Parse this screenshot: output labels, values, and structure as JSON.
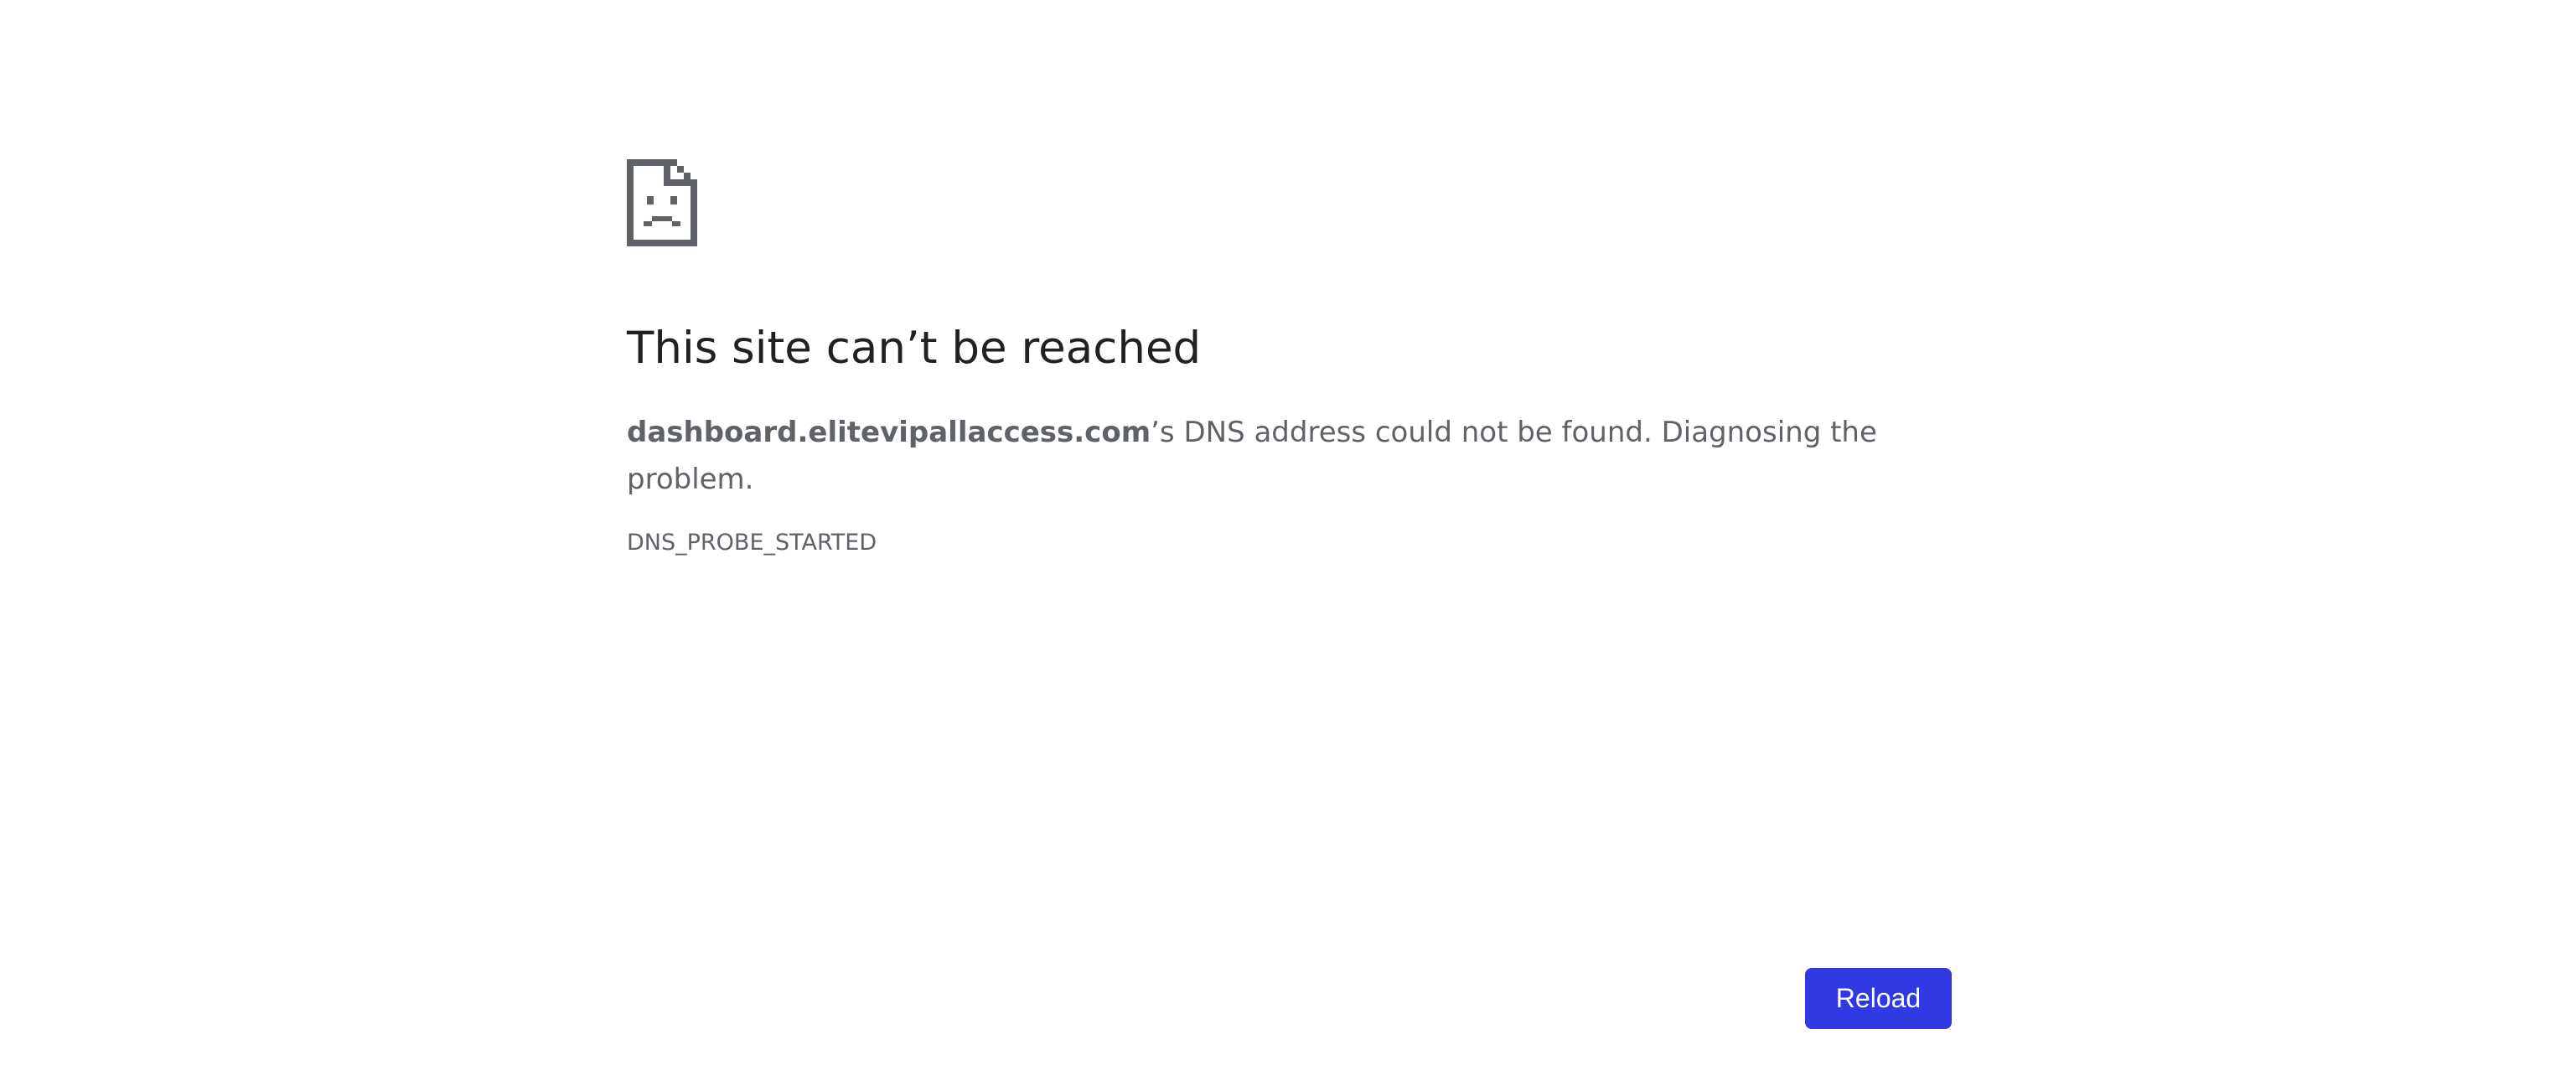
{
  "error": {
    "icon": "sad-document-icon",
    "title": "This site can’t be reached",
    "host": "dashboard.elitevipallaccess.com",
    "message_suffix": "’s DNS address could not be found. Diagnosing the problem.",
    "code": "DNS_PROBE_STARTED"
  },
  "actions": {
    "reload_label": "Reload"
  },
  "colors": {
    "icon": "#5f6368",
    "title": "#202124",
    "body_text": "#5f6368",
    "button_bg": "#3139e3",
    "button_text": "#ffffff",
    "page_bg": "#ffffff"
  }
}
